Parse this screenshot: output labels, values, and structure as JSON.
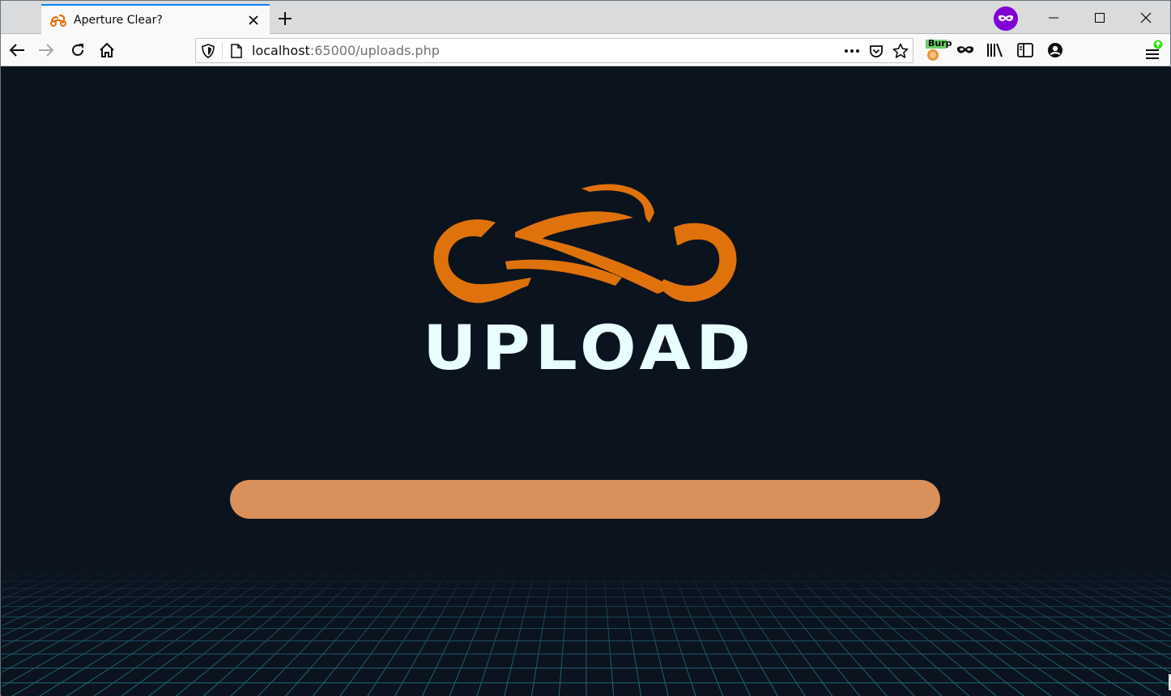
{
  "browser": {
    "tab_title": "Aperture Clear?",
    "url_host": "localhost",
    "url_path": ":65000/uploads.php",
    "extension_badge": "Burp"
  },
  "page": {
    "heading": "UPLOAD",
    "colors": {
      "background": "#0b131e",
      "logo_orange": "#e0720b",
      "upload_bar": "#d9905a",
      "heading_text": "#e8feff",
      "grid_lines": "#2a8aa0"
    }
  },
  "icons": {
    "tab": "aperture-logo-icon",
    "close": "close-icon",
    "new_tab": "plus-icon",
    "private": "private-browsing-mask-icon",
    "back": "arrow-left-icon",
    "forward": "arrow-right-icon",
    "reload": "reload-icon",
    "home": "home-icon",
    "shield": "shield-icon",
    "page": "page-icon",
    "more": "more-dots-icon",
    "pocket": "pocket-icon",
    "bookmark": "star-icon",
    "burp": "burp-extension-icon",
    "mask": "mask-icon",
    "library": "library-icon",
    "sidebar": "sidebar-icon",
    "account": "account-icon",
    "menu": "hamburger-menu-icon"
  }
}
